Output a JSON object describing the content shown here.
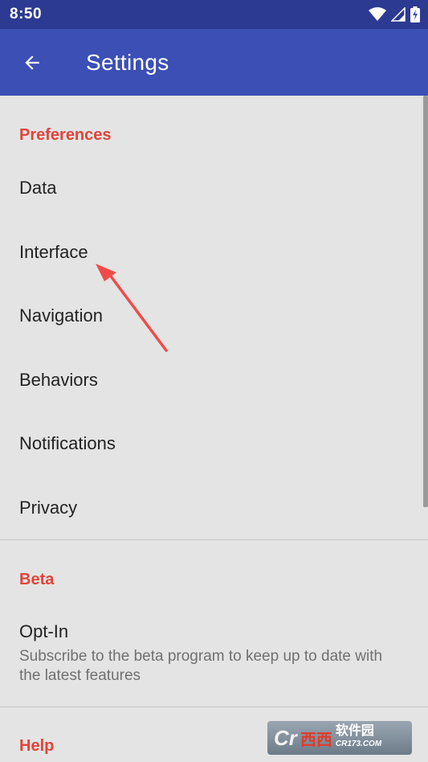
{
  "status_bar": {
    "time": "8:50"
  },
  "app_bar": {
    "title": "Settings"
  },
  "sections": {
    "preferences": {
      "header": "Preferences",
      "items": [
        "Data",
        "Interface",
        "Navigation",
        "Behaviors",
        "Notifications",
        "Privacy"
      ]
    },
    "beta": {
      "header": "Beta",
      "optin_title": "Opt-In",
      "optin_summary": "Subscribe to the beta program to keep up to date with the latest features"
    },
    "help": {
      "header": "Help"
    }
  },
  "watermark": {
    "text_main": "西西",
    "text_cn": "软件园",
    "text_en": "CR173.COM"
  },
  "colors": {
    "status_bar": "#2c3a91",
    "app_bar": "#3c4fb5",
    "accent": "#e0443a",
    "background": "#e4e4e4",
    "annotation_arrow": "#f04b4b"
  },
  "icons": {
    "back": "arrow-back-icon",
    "wifi": "wifi-icon",
    "signal": "signal-icon",
    "battery": "battery-charging-icon"
  }
}
